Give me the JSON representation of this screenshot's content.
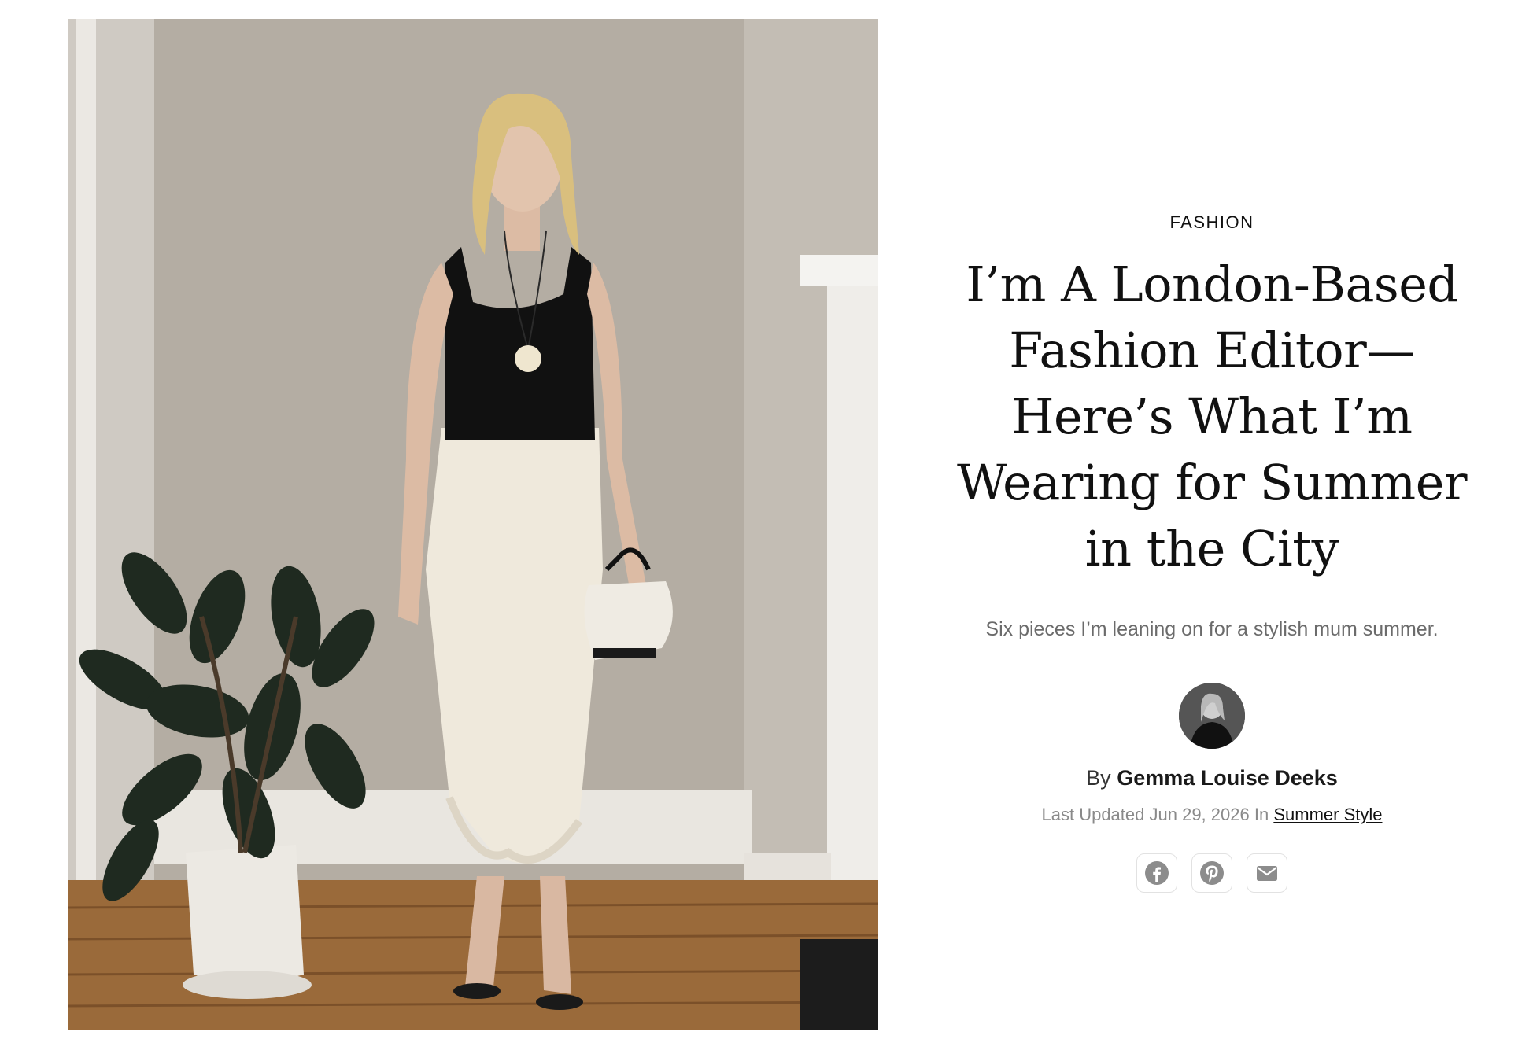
{
  "hero": {
    "alt_subject": "woman-standing-by-plant"
  },
  "article": {
    "category": "FASHION",
    "headline": "I’m A London-Based Fashion Editor—Here’s What I’m Wearing for Summer in the City",
    "standfirst": "Six pieces I’m leaning on for a stylish mum summer.",
    "byline_prefix": "By",
    "author": "Gemma Louise Deeks",
    "updated_prefix": "Last Updated",
    "updated_date": "Jun 29, 2026",
    "in_label": "In",
    "section_link": "Summer Style"
  },
  "share": {
    "icons": [
      "facebook-icon",
      "pinterest-icon",
      "email-icon"
    ]
  },
  "colors": {
    "text": "#111111",
    "muted": "#8a8a8a",
    "standfirst": "#6b6b6b",
    "share_icon": "#8c8c8c"
  }
}
